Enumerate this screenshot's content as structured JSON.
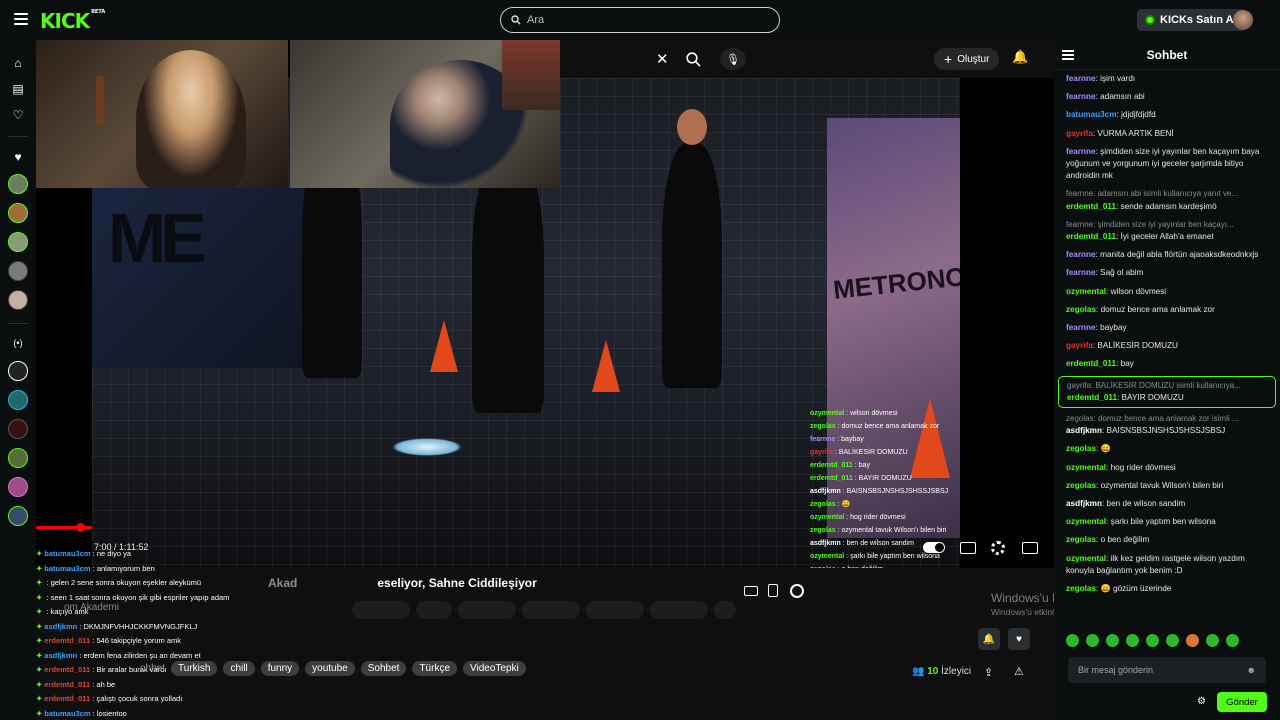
{
  "topbar": {
    "logo": "KICK",
    "logo_badge": "BETA",
    "search_placeholder": "Ara",
    "buy_label": "KICKs Satın Al"
  },
  "youtube_bar": {
    "create_label": "Oluştur"
  },
  "video": {
    "time": "7:00 / 1:11:52",
    "title_faded": "Akad",
    "title": "eseliyor, Sahne Ciddileşiyor",
    "channel": "om Akademi"
  },
  "left_chat": [
    {
      "user": "batumau3cm",
      "text": "ne diyo ya",
      "color": "#3ba2ff"
    },
    {
      "user": "batumau3cm",
      "text": "anlamıyorum ben",
      "color": "#3ba2ff"
    },
    {
      "user": "",
      "text": "gelen 2 sene sonra okuyon eşekler aleykümü",
      "color": "#d4483b"
    },
    {
      "user": "",
      "text": "seen 1 saat sonra okuyon şik gibi espriler yapıp adam",
      "color": "#ffffff"
    },
    {
      "user": "",
      "text": "kaçıyo amk",
      "color": "#ffffff"
    },
    {
      "user": "asdfjkmn",
      "text": "DKMJNFVHHJCKKFMVNGJFKLJ",
      "color": "#3ba2ff"
    },
    {
      "user": "erdemtd_011",
      "text": "546 takipçiyle yorum amk",
      "color": "#d4483b"
    },
    {
      "user": "asdfjkmn",
      "text": "erdem fena zilirden şu an devam et",
      "color": "#3ba2ff"
    },
    {
      "user": "erdemtd_011",
      "text": "Bir aralar burak vardı",
      "color": "#d4483b"
    },
    {
      "user": "erdemtd_011",
      "text": "ah be",
      "color": "#d4483b"
    },
    {
      "user": "erdemtd_011",
      "text": "çalıştı çocuk sonra yolladı",
      "color": "#d4483b"
    },
    {
      "user": "batumau3cm",
      "text": "losientoo",
      "color": "#3ba2ff"
    }
  ],
  "video_overlay_chat": [
    {
      "user": "ozymental",
      "text": "wilson dövmesi",
      "color": "#53fc18"
    },
    {
      "user": "zegolas",
      "text": "domuz bence ama anlamak zor",
      "color": "#53fc18"
    },
    {
      "user": "fearnne",
      "text": "baybay",
      "color": "#a78bfa"
    },
    {
      "user": "gayrifa",
      "text": "BALİKESİR DOMUZU",
      "color": "#e03434"
    },
    {
      "user": "erdemtd_011",
      "text": "bay",
      "color": "#53fc18"
    },
    {
      "user": "erdemtd_011",
      "text": "BAYIR DOMUZU",
      "color": "#53fc18"
    },
    {
      "user": "asdfjkmn",
      "text": "BAISNSBSJNSHSJSHSSJSBSJ",
      "color": "#ffffff"
    },
    {
      "user": "zegolas",
      "text": "😄",
      "color": "#53fc18"
    },
    {
      "user": "ozymental",
      "text": "hog rider dövmesi",
      "color": "#53fc18"
    },
    {
      "user": "zegolas",
      "text": "ozymental tavuk Wilson'ı bilen biri",
      "color": "#53fc18"
    },
    {
      "user": "asdfjkmn",
      "text": "ben de wilson sandim",
      "color": "#ffffff"
    },
    {
      "user": "ozymental",
      "text": "şarkı bile yaptım ben wilsona",
      "color": "#53fc18"
    },
    {
      "user": "zegolas",
      "text": "o ben değilim",
      "color": "#53fc18"
    },
    {
      "user": "ozymental",
      "text": "ilk kez geldim rastgele wilson yazdım konuyla bağlantım yok be",
      "color": "#53fc18"
    },
    {
      "user": "zegolas",
      "text": "😄 gözüm üzerinde",
      "color": "#53fc18"
    }
  ],
  "tags": {
    "label": "ohbet",
    "items": [
      "Turkish",
      "chill",
      "funny",
      "youtube",
      "Sohbet",
      "Türkçe",
      "VideoTepki"
    ]
  },
  "viewers": {
    "count": "10",
    "label": "İzleyici"
  },
  "watermark": {
    "title": "Windows'u Etkinleştir",
    "subtitle": "Windows'u etkinleştirmek için Ayarlar'a gidin."
  },
  "chat": {
    "title": "Sohbet",
    "input_placeholder": "Bir mesaj gönderin",
    "send_label": "Gönder",
    "messages": [
      {
        "user": "fearnne",
        "text": "işim vardı",
        "color": "#a78bfa"
      },
      {
        "user": "fearnne",
        "text": "adamsın abi",
        "color": "#a78bfa"
      },
      {
        "user": "batumau3cm",
        "text": "jdjdjfdjdfd",
        "color": "#3ba2ff"
      },
      {
        "user": "gayrifa",
        "text": "VURMA ARTIK BENİ",
        "color": "#e03434"
      },
      {
        "user": "fearnne",
        "text": "şimdiden size iyi yayınlar ben kaçayım baya yoğunum ve yorgunum iyi geceler şarjımda bitiyo androidin mk",
        "color": "#a78bfa"
      },
      {
        "reply": "fearnne: adamsın abi isimli kullanıcıya yanıt ve...",
        "user": "erdemtd_011",
        "text": "sende adamsın kardeşimö",
        "color": "#53fc18"
      },
      {
        "reply": "fearnne: şimdiden size iyi yayınlar ben kaçayı...",
        "user": "erdemtd_011",
        "text": "İyi geceler Allah'a emanet",
        "color": "#53fc18"
      },
      {
        "user": "fearnne",
        "text": "manita değil abla flörtün ajaoaksdkeodnkxjs",
        "color": "#a78bfa"
      },
      {
        "user": "fearnne",
        "text": "Sağ ol abim",
        "color": "#a78bfa"
      },
      {
        "user": "ozymental",
        "text": "wilson dövmesi",
        "color": "#53fc18"
      },
      {
        "user": "zegolas",
        "text": "domuz bence ama anlamak zor",
        "color": "#53fc18"
      },
      {
        "user": "fearnne",
        "text": "baybay",
        "color": "#a78bfa"
      },
      {
        "user": "gayrifa",
        "text": "BALİKESİR DOMUZU",
        "color": "#e03434"
      },
      {
        "user": "erdemtd_011",
        "text": "bay",
        "color": "#53fc18"
      },
      {
        "reply": "gayrifa: BALİKESİR DOMUZU isimli kullanıcıya...",
        "user": "erdemtd_011",
        "text": "BAYIR DOMUZU",
        "color": "#53fc18",
        "highlight": true
      },
      {
        "reply": "zegolas: domuz bence ama anlamak zor isimli ...",
        "user": "asdfjkmn",
        "text": "BAISNSBSJNSHSJSHSSJSBSJ",
        "color": "#ffffff"
      },
      {
        "user": "zegolas",
        "text": "😄",
        "color": "#53fc18"
      },
      {
        "user": "ozymental",
        "text": "hog rider dövmesi",
        "color": "#53fc18"
      },
      {
        "user": "zegolas",
        "text": "ozymental tavuk Wilson'ı bilen biri",
        "color": "#53fc18"
      },
      {
        "user": "asdfjkmn",
        "text": "ben de wilson sandim",
        "color": "#ffffff"
      },
      {
        "user": "ozymental",
        "text": "şarkı bile yaptım ben wilsona",
        "color": "#53fc18"
      },
      {
        "user": "zegolas",
        "text": "o ben değilim",
        "color": "#53fc18"
      },
      {
        "user": "ozymental",
        "text": "ilk kez geldim rastgele wilson yazdım konuyla bağlantım yok benim :D",
        "color": "#53fc18"
      },
      {
        "user": "zegolas",
        "text": "😄 gözüm üzerinde",
        "color": "#53fc18"
      }
    ]
  },
  "colors": {
    "accent": "#53fc18",
    "background": "#0b0e0f",
    "youtube_red": "#ff0000"
  }
}
